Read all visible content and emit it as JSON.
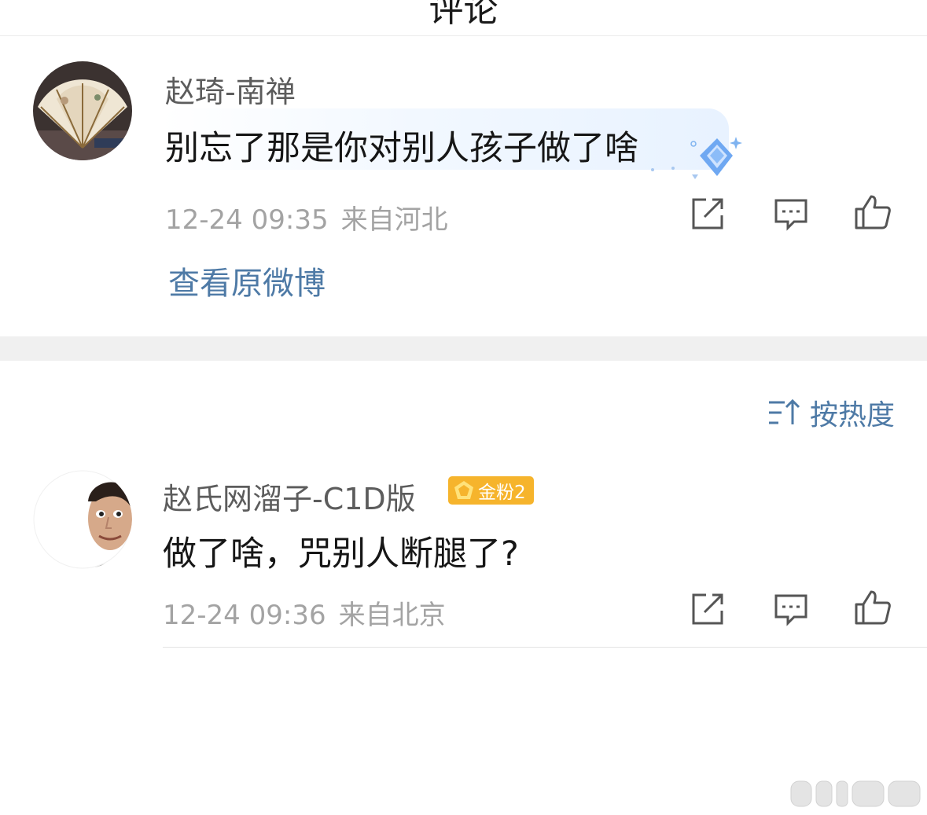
{
  "header": {
    "title": "评论"
  },
  "original_post": {
    "author": "赵琦-南禅",
    "content": "别忘了那是你对别人孩子做了啥",
    "time": "12-24 09:35",
    "location": "来自河北",
    "view_link": "查看原微博"
  },
  "sort": {
    "label": "按热度"
  },
  "comments": [
    {
      "author": "赵氏网溜子-C1D版",
      "badge": "金粉2",
      "content": "做了啥，咒别人断腿了?",
      "time": "12-24 09:36",
      "location": "来自北京"
    }
  ],
  "colors": {
    "link": "#4e7aa6",
    "badge": "#f6b42c",
    "meta_text": "#a3a3a3",
    "icon": "#555555"
  },
  "icons": [
    "back-icon",
    "share-icon",
    "comment-icon",
    "like-icon",
    "sort-icon",
    "diamond-badge-icon",
    "fan-badge-icon"
  ]
}
